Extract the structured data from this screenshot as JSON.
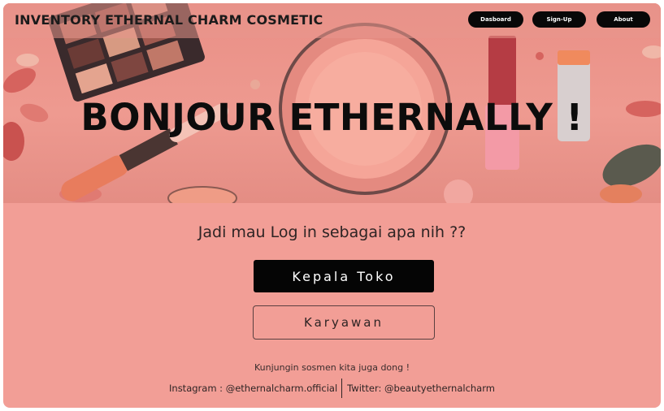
{
  "navbar": {
    "brand": "INVENTORY ETHERNAL CHARM COSMETIC",
    "links": [
      "Dasboard",
      "Sign-Up",
      "About"
    ]
  },
  "hero": {
    "title": "BONJOUR ETHERNALLY !"
  },
  "login": {
    "question": "Jadi mau Log in sebagai apa nih ??",
    "primary_label": "Kepala Toko",
    "secondary_label": "Karyawan"
  },
  "social": {
    "note": "Kunjungin sosmen kita juga dong !",
    "instagram": "Instagram : @ethernalcharm.official",
    "twitter": "Twitter: @beautyethernalcharm"
  },
  "colors": {
    "background": "#f29e96",
    "button_dark": "#050505",
    "text_dark": "#2e2424"
  }
}
